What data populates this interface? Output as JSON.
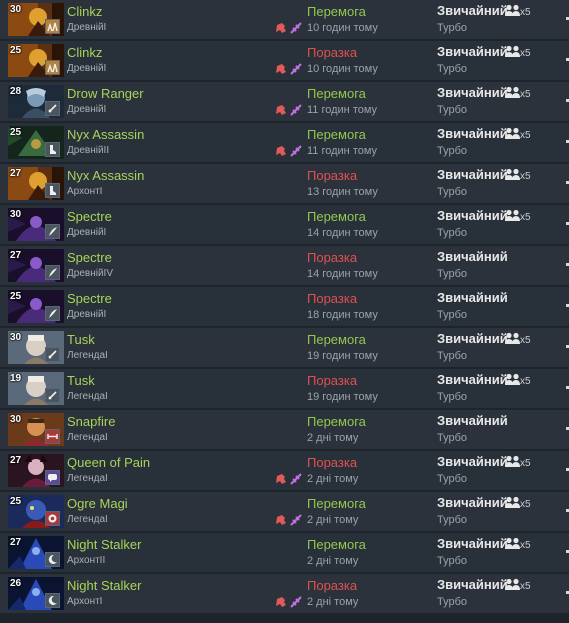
{
  "matches": [
    {
      "hero": "Clinkz",
      "hero_icon": "clinkz-portrait",
      "level": "30",
      "rank": "ДревнійI",
      "role_icon": "support-icon",
      "role_color": "#b4823a",
      "items": true,
      "result": "Перемога",
      "outcome": "win",
      "time": "10 годин тому",
      "mode": "Звичайний",
      "submode": "Турбо",
      "party": "x5"
    },
    {
      "hero": "Clinkz",
      "hero_icon": "clinkz-portrait",
      "level": "25",
      "rank": "ДревнійI",
      "role_icon": "support-icon",
      "role_color": "#b4823a",
      "items": true,
      "result": "Поразка",
      "outcome": "loss",
      "time": "10 годин тому",
      "mode": "Звичайний",
      "submode": "Турбо",
      "party": "x5"
    },
    {
      "hero": "Drow Ranger",
      "hero_icon": "drow-ranger-portrait",
      "level": "28",
      "rank": "ДревнійI",
      "role_icon": "sword-icon",
      "role_color": "#4a5560",
      "items": true,
      "result": "Перемога",
      "outcome": "win",
      "time": "11 годин тому",
      "mode": "Звичайний",
      "submode": "Турбо",
      "party": "x5"
    },
    {
      "hero": "Nyx Assassin",
      "hero_icon": "nyx-assassin-portrait",
      "level": "25",
      "rank": "ДревнійII",
      "role_icon": "boot-icon",
      "role_color": "#4a5560",
      "items": true,
      "result": "Перемога",
      "outcome": "win",
      "time": "11 годин тому",
      "mode": "Звичайний",
      "submode": "Турбо",
      "party": "x5"
    },
    {
      "hero": "Nyx Assassin",
      "hero_icon": "clinkz-portrait",
      "level": "27",
      "rank": "АрхонтI",
      "role_icon": "boot-icon",
      "role_color": "#4a5560",
      "items": false,
      "result": "Поразка",
      "outcome": "loss",
      "time": "13 годин тому",
      "mode": "Звичайний",
      "submode": "Турбо",
      "party": "x5"
    },
    {
      "hero": "Spectre",
      "hero_icon": "spectre-portrait",
      "level": "30",
      "rank": "ДревнійI",
      "role_icon": "blade-icon",
      "role_color": "#4a5560",
      "items": false,
      "result": "Перемога",
      "outcome": "win",
      "time": "14 годин тому",
      "mode": "Звичайний",
      "submode": "Турбо",
      "party": "x5"
    },
    {
      "hero": "Spectre",
      "hero_icon": "spectre-portrait",
      "level": "27",
      "rank": "ДревнійIV",
      "role_icon": "blade-icon",
      "role_color": "#4a5560",
      "items": false,
      "result": "Поразка",
      "outcome": "loss",
      "time": "14 годин тому",
      "mode": "Звичайний",
      "submode": "Турбо",
      "party": ""
    },
    {
      "hero": "Spectre",
      "hero_icon": "spectre-portrait",
      "level": "25",
      "rank": "ДревнійI",
      "role_icon": "blade-icon",
      "role_color": "#4a5560",
      "items": false,
      "result": "Поразка",
      "outcome": "loss",
      "time": "18 годин тому",
      "mode": "Звичайний",
      "submode": "Турбо",
      "party": ""
    },
    {
      "hero": "Tusk",
      "hero_icon": "tusk-portrait",
      "level": "30",
      "rank": "ЛегендаI",
      "role_icon": "sword-icon",
      "role_color": "#4a5560",
      "items": false,
      "result": "Перемога",
      "outcome": "win",
      "time": "19 годин тому",
      "mode": "Звичайний",
      "submode": "Турбо",
      "party": "x5"
    },
    {
      "hero": "Tusk",
      "hero_icon": "tusk-portrait",
      "level": "19",
      "rank": "ЛегендаI",
      "role_icon": "sword-icon",
      "role_color": "#4a5560",
      "items": false,
      "result": "Поразка",
      "outcome": "loss",
      "time": "19 годин тому",
      "mode": "Звичайний",
      "submode": "Турбо",
      "party": "x5"
    },
    {
      "hero": "Snapfire",
      "hero_icon": "snapfire-portrait",
      "level": "30",
      "rank": "ЛегендаI",
      "role_icon": "arrows-icon",
      "role_color": "#a83a3a",
      "items": false,
      "result": "Перемога",
      "outcome": "win",
      "time": "2 дні тому",
      "mode": "Звичайний",
      "submode": "Турбо",
      "party": ""
    },
    {
      "hero": "Queen of Pain",
      "hero_icon": "queen-of-pain-portrait",
      "level": "27",
      "rank": "ЛегендаI",
      "role_icon": "chat-icon",
      "role_color": "#5a4a9a",
      "items": true,
      "result": "Поразка",
      "outcome": "loss",
      "time": "2 дні тому",
      "mode": "Звичайний",
      "submode": "Турбо",
      "party": "x5"
    },
    {
      "hero": "Ogre Magi",
      "hero_icon": "ogre-magi-portrait",
      "level": "25",
      "rank": "ЛегендаI",
      "role_icon": "gem-icon",
      "role_color": "#a83a3a",
      "items": true,
      "result": "Перемога",
      "outcome": "win",
      "time": "2 дні тому",
      "mode": "Звичайний",
      "submode": "Турбо",
      "party": "x5"
    },
    {
      "hero": "Night Stalker",
      "hero_icon": "night-stalker-portrait",
      "level": "27",
      "rank": "АрхонтII",
      "role_icon": "moon-icon",
      "role_color": "#4a5560",
      "items": false,
      "result": "Перемога",
      "outcome": "win",
      "time": "2 дні тому",
      "mode": "Звичайний",
      "submode": "Турбо",
      "party": "x5"
    },
    {
      "hero": "Night Stalker",
      "hero_icon": "night-stalker-portrait",
      "level": "26",
      "rank": "АрхонтI",
      "role_icon": "moon-icon",
      "role_color": "#4a5560",
      "items": true,
      "result": "Поразка",
      "outcome": "loss",
      "time": "2 дні тому",
      "mode": "Звичайний",
      "submode": "Турбо",
      "party": "x5"
    }
  ],
  "colors": {
    "background": "#1e242c",
    "row": "#2b323c",
    "hero_name": "#a8d45a",
    "win": "#92c84e",
    "loss": "#e05151",
    "item_a": "#e05a5a",
    "item_b": "#c070e0"
  }
}
